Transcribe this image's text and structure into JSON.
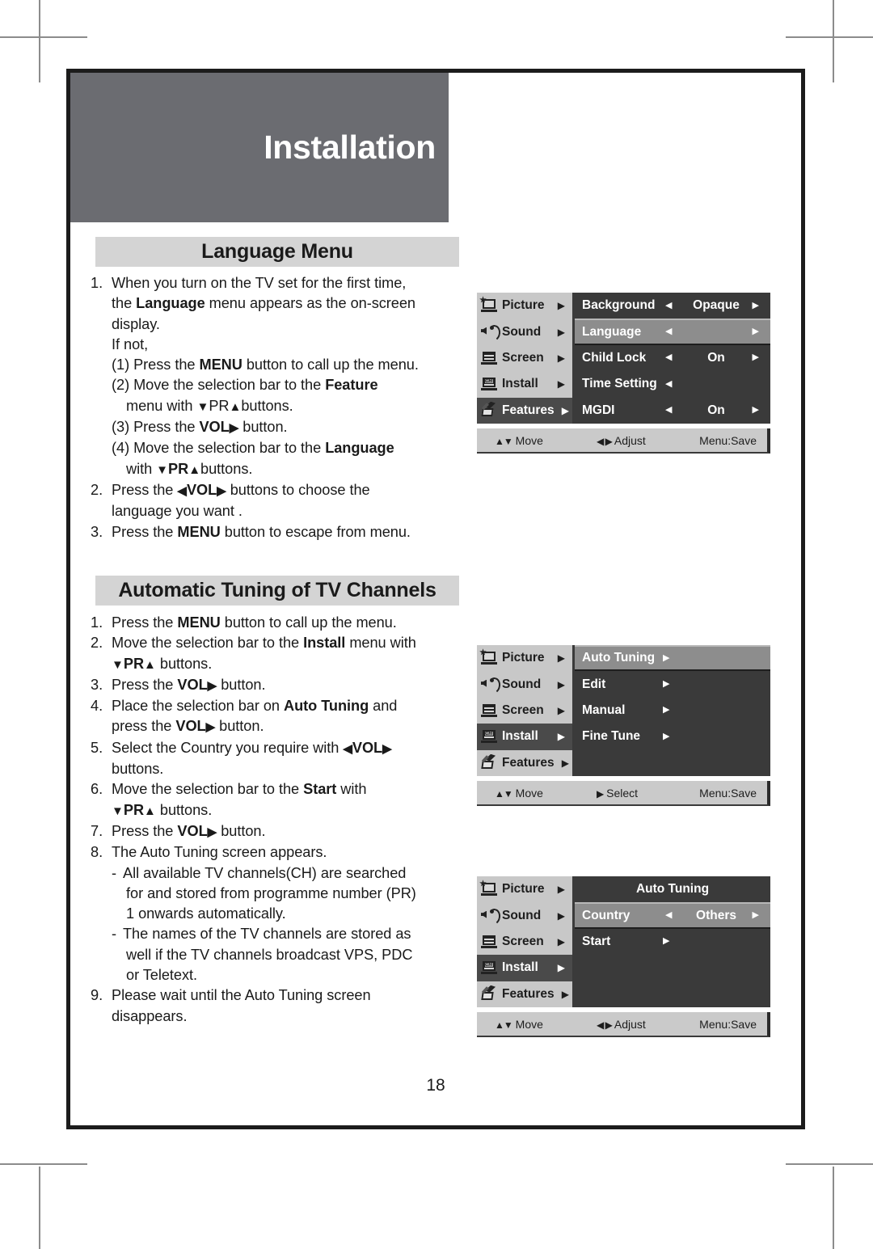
{
  "chapter": {
    "title": "Installation"
  },
  "page": {
    "number": "18"
  },
  "sections": {
    "language": {
      "heading": "Language Menu",
      "steps": [
        {
          "num": "1.",
          "parts": [
            {
              "t": "When you turn on the TV set for the first time,",
              "b": false
            }
          ]
        },
        {
          "indent": 1,
          "parts": [
            {
              "t": "the ",
              "b": false
            },
            {
              "t": "Language",
              "b": true
            },
            {
              "t": " menu appears as the on-screen",
              "b": false
            }
          ]
        },
        {
          "indent": 1,
          "parts": [
            {
              "t": "display.",
              "b": false
            }
          ]
        },
        {
          "indent": 1,
          "parts": [
            {
              "t": "If not,",
              "b": false
            }
          ]
        },
        {
          "indent": 1,
          "parts": [
            {
              "t": "(1) Press the ",
              "b": false
            },
            {
              "t": "MENU",
              "b": true
            },
            {
              "t": " button to call up the menu.",
              "b": false
            }
          ]
        },
        {
          "indent": 1,
          "parts": [
            {
              "t": "(2) Move the selection bar to the ",
              "b": false
            },
            {
              "t": "Feature",
              "b": true
            }
          ]
        },
        {
          "indent": 2,
          "parts": [
            {
              "t": "menu with ",
              "b": false
            },
            {
              "t": "▼",
              "b": false,
              "a": true
            },
            {
              "t": "PR",
              "b": false
            },
            {
              "t": "▲",
              "b": false,
              "a": true
            },
            {
              "t": "buttons.",
              "b": false
            }
          ]
        },
        {
          "indent": 1,
          "parts": [
            {
              "t": "(3) Press the ",
              "b": false
            },
            {
              "t": "VOL",
              "b": true
            },
            {
              "t": "▶",
              "b": true,
              "a": true
            },
            {
              "t": " button.",
              "b": false
            }
          ]
        },
        {
          "indent": 1,
          "parts": [
            {
              "t": "(4) Move the selection bar to the ",
              "b": false
            },
            {
              "t": "Language",
              "b": true
            }
          ]
        },
        {
          "indent": 2,
          "parts": [
            {
              "t": "with ",
              "b": false
            },
            {
              "t": "▼",
              "b": true,
              "a": true
            },
            {
              "t": "PR",
              "b": true
            },
            {
              "t": "▲",
              "b": true,
              "a": true
            },
            {
              "t": "buttons.",
              "b": false
            }
          ]
        },
        {
          "num": "2.",
          "parts": [
            {
              "t": "Press the ",
              "b": false
            },
            {
              "t": "◀",
              "b": true,
              "a": true
            },
            {
              "t": "VOL",
              "b": true
            },
            {
              "t": "▶",
              "b": true,
              "a": true
            },
            {
              "t": " buttons to choose the",
              "b": false
            }
          ]
        },
        {
          "indent": 1,
          "parts": [
            {
              "t": "language you want .",
              "b": false
            }
          ]
        },
        {
          "num": "3.",
          "parts": [
            {
              "t": "Press the ",
              "b": false
            },
            {
              "t": "MENU",
              "b": true
            },
            {
              "t": " button to escape from menu.",
              "b": false
            }
          ]
        }
      ]
    },
    "auto_tuning": {
      "heading": "Automatic Tuning of TV Channels",
      "steps": [
        {
          "num": "1.",
          "parts": [
            {
              "t": "Press the ",
              "b": false
            },
            {
              "t": "MENU",
              "b": true
            },
            {
              "t": " button to call up the menu.",
              "b": false
            }
          ]
        },
        {
          "num": "2.",
          "parts": [
            {
              "t": "Move the selection bar to the ",
              "b": false
            },
            {
              "t": "Install",
              "b": true
            },
            {
              "t": " menu with",
              "b": false
            }
          ]
        },
        {
          "indent": 1,
          "parts": [
            {
              "t": "▼",
              "b": true,
              "a": true
            },
            {
              "t": "PR",
              "b": true
            },
            {
              "t": "▲",
              "b": true,
              "a": true
            },
            {
              "t": " buttons.",
              "b": false
            }
          ]
        },
        {
          "num": "3.",
          "parts": [
            {
              "t": "Press the ",
              "b": false
            },
            {
              "t": "VOL",
              "b": true
            },
            {
              "t": "▶",
              "b": true,
              "a": true
            },
            {
              "t": " button.",
              "b": false
            }
          ]
        },
        {
          "num": "4.",
          "parts": [
            {
              "t": "Place the selection bar on ",
              "b": false
            },
            {
              "t": "Auto Tuning",
              "b": true
            },
            {
              "t": " and",
              "b": false
            }
          ]
        },
        {
          "indent": 1,
          "parts": [
            {
              "t": "press the ",
              "b": false
            },
            {
              "t": "VOL",
              "b": true
            },
            {
              "t": "▶",
              "b": true,
              "a": true
            },
            {
              "t": " button.",
              "b": false
            }
          ]
        },
        {
          "num": "5.",
          "parts": [
            {
              "t": "Select the Country you require with ",
              "b": false
            },
            {
              "t": "◀",
              "b": true,
              "a": true
            },
            {
              "t": "VOL",
              "b": true
            },
            {
              "t": "▶",
              "b": true,
              "a": true
            }
          ]
        },
        {
          "indent": 1,
          "parts": [
            {
              "t": "buttons.",
              "b": false
            }
          ]
        },
        {
          "num": "6.",
          "parts": [
            {
              "t": "Move the selection bar to the ",
              "b": false
            },
            {
              "t": "Start",
              "b": true
            },
            {
              "t": " with",
              "b": false
            }
          ]
        },
        {
          "indent": 1,
          "parts": [
            {
              "t": "▼",
              "b": true,
              "a": true
            },
            {
              "t": "PR",
              "b": true
            },
            {
              "t": "▲",
              "b": true,
              "a": true
            },
            {
              "t": " buttons.",
              "b": false
            }
          ]
        },
        {
          "num": "7.",
          "parts": [
            {
              "t": "Press the ",
              "b": false
            },
            {
              "t": "VOL",
              "b": true
            },
            {
              "t": "▶",
              "b": true,
              "a": true
            },
            {
              "t": " button.",
              "b": false
            }
          ]
        },
        {
          "num": "8.",
          "parts": [
            {
              "t": "The Auto Tuning screen appears.",
              "b": false
            }
          ]
        },
        {
          "dash": true,
          "parts": [
            {
              "t": "All available TV channels(CH) are searched",
              "b": false
            }
          ]
        },
        {
          "indent": 2,
          "parts": [
            {
              "t": "for and stored from programme number (PR)",
              "b": false
            }
          ]
        },
        {
          "indent": 2,
          "parts": [
            {
              "t": "1 onwards automatically.",
              "b": false
            }
          ]
        },
        {
          "dash": true,
          "parts": [
            {
              "t": "The names of the TV channels are stored as",
              "b": false
            }
          ]
        },
        {
          "indent": 2,
          "parts": [
            {
              "t": "well if the TV channels broadcast VPS, PDC",
              "b": false
            }
          ]
        },
        {
          "indent": 2,
          "parts": [
            {
              "t": "or Teletext.",
              "b": false
            }
          ]
        },
        {
          "num": "9.",
          "parts": [
            {
              "t": "Please wait until the Auto Tuning screen",
              "b": false
            }
          ]
        },
        {
          "indent": 1,
          "parts": [
            {
              "t": "disappears.",
              "b": false
            }
          ]
        }
      ]
    }
  },
  "osd_menus": [
    {
      "id": "features-menu",
      "left_items": [
        {
          "label": "Picture",
          "icon": "picture-icon",
          "arrow": "▶",
          "selected": false
        },
        {
          "label": "Sound",
          "icon": "sound-icon",
          "arrow": "▶",
          "selected": false
        },
        {
          "label": "Screen",
          "icon": "screen-icon",
          "arrow": "▶",
          "selected": false
        },
        {
          "label": "Install",
          "icon": "install-icon",
          "arrow": "▶",
          "selected": false
        },
        {
          "label": "Features",
          "icon": "features-icon",
          "arrow": "▶",
          "selected": true
        }
      ],
      "right_items": [
        {
          "label": "Background",
          "left_arrow": "◀",
          "value": "Opaque",
          "right_arrow": "▶",
          "selected": false
        },
        {
          "label": "Language",
          "left_arrow": "◀",
          "value": "",
          "right_arrow": "▶",
          "selected": true
        },
        {
          "label": "Child Lock",
          "left_arrow": "◀",
          "value": "On",
          "right_arrow": "▶",
          "selected": false
        },
        {
          "label": "Time Setting",
          "left_arrow": "◀",
          "value": "",
          "right_arrow": "",
          "selected": false
        },
        {
          "label": "MGDI",
          "left_arrow": "◀",
          "value": "On",
          "right_arrow": "▶",
          "selected": false
        }
      ],
      "status": {
        "move_glyph": "▲▼",
        "move": "Move",
        "mid_glyph": "◀ ▶",
        "mid": "Adjust",
        "save": "Menu:Save"
      }
    },
    {
      "id": "install-menu",
      "left_items": [
        {
          "label": "Picture",
          "icon": "picture-icon",
          "arrow": "▶",
          "selected": false
        },
        {
          "label": "Sound",
          "icon": "sound-icon",
          "arrow": "▶",
          "selected": false
        },
        {
          "label": "Screen",
          "icon": "screen-icon",
          "arrow": "▶",
          "selected": false
        },
        {
          "label": "Install",
          "icon": "install-icon",
          "arrow": "▶",
          "selected": true
        },
        {
          "label": "Features",
          "icon": "features-icon",
          "arrow": "▶",
          "selected": false
        }
      ],
      "right_items": [
        {
          "label": "Auto Tuning",
          "sub_arrow": "▶",
          "selected": true
        },
        {
          "label": "Edit",
          "sub_arrow": "▶",
          "selected": false
        },
        {
          "label": "Manual",
          "sub_arrow": "▶",
          "selected": false
        },
        {
          "label": "Fine Tune",
          "sub_arrow": "▶",
          "selected": false
        }
      ],
      "status": {
        "move_glyph": "▲▼",
        "move": "Move",
        "mid_glyph": "▶",
        "mid": "Select",
        "save": "Menu:Save"
      }
    },
    {
      "id": "auto-tuning-menu",
      "left_items": [
        {
          "label": "Picture",
          "icon": "picture-icon",
          "arrow": "▶",
          "selected": false
        },
        {
          "label": "Sound",
          "icon": "sound-icon",
          "arrow": "▶",
          "selected": false
        },
        {
          "label": "Screen",
          "icon": "screen-icon",
          "arrow": "▶",
          "selected": false
        },
        {
          "label": "Install",
          "icon": "install-icon",
          "arrow": "▶",
          "selected": true
        },
        {
          "label": "Features",
          "icon": "features-icon",
          "arrow": "▶",
          "selected": false
        }
      ],
      "panel_title": "Auto Tuning",
      "right_items": [
        {
          "label": "Country",
          "left_arrow": "◀",
          "value": "Others",
          "right_arrow": "▶",
          "selected": true
        },
        {
          "label": "Start",
          "sub_arrow": "▶",
          "selected": false
        }
      ],
      "status": {
        "move_glyph": "▲▼",
        "move": "Move",
        "mid_glyph": "◀ ▶",
        "mid": "Adjust",
        "save": "Menu:Save"
      }
    }
  ],
  "colors": {
    "chapter_band": "#6b6c71",
    "section_bar": "#d4d4d4",
    "osd_left_bg": "#c8c8c8",
    "osd_right_bg": "#3a3a3a",
    "osd_highlight": "#8d8d8d",
    "osd_left_selected": "#4a4a4a",
    "frame": "#1c1c1c"
  }
}
